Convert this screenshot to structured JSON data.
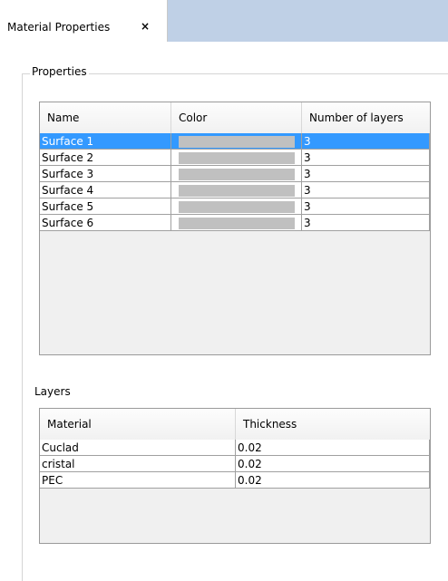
{
  "tab": {
    "label": "Material Properties",
    "close_glyph": "×"
  },
  "properties": {
    "title": "Properties",
    "columns": [
      "Name",
      "Color",
      "Number of layers"
    ],
    "rows": [
      {
        "name": "Surface 1",
        "color": "#c0c0c0",
        "layers": "3",
        "selected": true
      },
      {
        "name": "Surface 2",
        "color": "#c0c0c0",
        "layers": "3"
      },
      {
        "name": "Surface 3",
        "color": "#c0c0c0",
        "layers": "3"
      },
      {
        "name": "Surface 4",
        "color": "#c0c0c0",
        "layers": "3"
      },
      {
        "name": "Surface 5",
        "color": "#c0c0c0",
        "layers": "3"
      },
      {
        "name": "Surface 6",
        "color": "#c0c0c0",
        "layers": "3"
      }
    ]
  },
  "layers": {
    "title": "Layers",
    "columns": [
      "Material",
      "Thickness"
    ],
    "rows": [
      {
        "material": "Cuclad",
        "thickness": "0.02"
      },
      {
        "material": "cristal",
        "thickness": "0.02"
      },
      {
        "material": "PEC",
        "thickness": "0.02"
      }
    ]
  },
  "colors": {
    "selection": "#3399ff",
    "tabstrip": "#bfd0e6"
  }
}
